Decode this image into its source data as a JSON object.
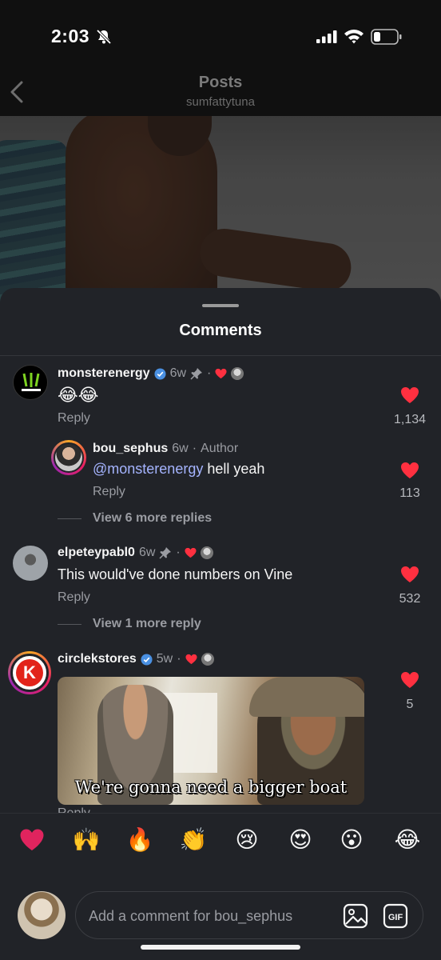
{
  "status_bar": {
    "time": "2:03"
  },
  "header": {
    "title": "Posts",
    "subtitle": "sumfattytuna"
  },
  "sheet": {
    "title": "Comments"
  },
  "comments": [
    {
      "username": "monsterenergy",
      "verified": true,
      "age": "6w",
      "pinned": true,
      "text": "😂😂",
      "reply_label": "Reply",
      "likes": "1,134",
      "replies": [
        {
          "username": "bou_sephus",
          "age": "6w",
          "author_tag": "Author",
          "mention": "@monsterenergy",
          "text": " hell yeah",
          "reply_label": "Reply",
          "likes": "113"
        }
      ],
      "view_more": "View 6 more replies"
    },
    {
      "username": "elpeteypabl0",
      "verified": false,
      "age": "6w",
      "pinned": true,
      "text": "This would've done numbers on Vine",
      "reply_label": "Reply",
      "likes": "532",
      "view_more": "View 1 more reply"
    },
    {
      "username": "circlekstores",
      "verified": true,
      "age": "5w",
      "pinned": false,
      "gif_caption": "We're gonna need a bigger boat",
      "reply_label": "Reply",
      "likes": "5"
    }
  ],
  "meta_separator": "·",
  "emoji_bar": [
    "🙌",
    "🔥",
    "👏",
    "😢",
    "😍",
    "😮",
    "😂"
  ],
  "composer": {
    "placeholder": "Add a comment for bou_sephus",
    "gif_label": "GIF"
  },
  "colors": {
    "sheet_bg": "#212328",
    "heart": "#ff3040",
    "verified": "#4a90e2",
    "mention": "#a5b4ff"
  }
}
